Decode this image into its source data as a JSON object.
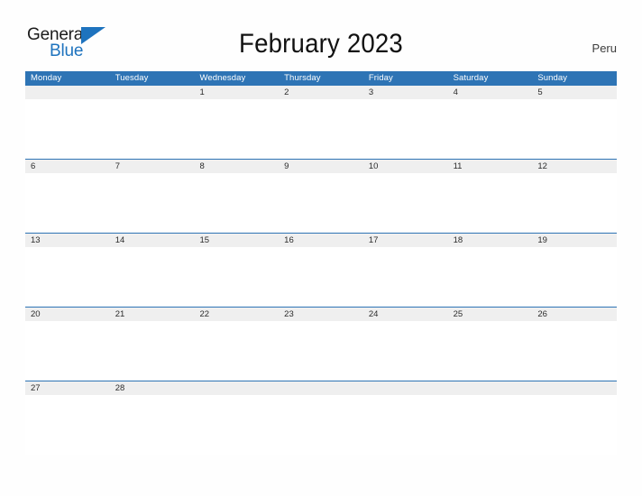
{
  "header": {
    "logo": {
      "text_primary": "General",
      "text_secondary": "Blue",
      "flag_icon": "blue-flag-triangle-icon"
    },
    "title": "February 2023",
    "country": "Peru"
  },
  "calendar": {
    "weekdays": [
      "Monday",
      "Tuesday",
      "Wednesday",
      "Thursday",
      "Friday",
      "Saturday",
      "Sunday"
    ],
    "weeks": [
      [
        "",
        "",
        "1",
        "2",
        "3",
        "4",
        "5"
      ],
      [
        "6",
        "7",
        "8",
        "9",
        "10",
        "11",
        "12"
      ],
      [
        "13",
        "14",
        "15",
        "16",
        "17",
        "18",
        "19"
      ],
      [
        "20",
        "21",
        "22",
        "23",
        "24",
        "25",
        "26"
      ],
      [
        "27",
        "28",
        "",
        "",
        "",
        "",
        ""
      ]
    ]
  },
  "colors": {
    "header_blue": "#2E74B5",
    "logo_blue": "#1E73BE",
    "date_band_gray": "#EFEFEF",
    "page_background": "#FEFEFE",
    "text_dark": "#1B1B1B"
  }
}
